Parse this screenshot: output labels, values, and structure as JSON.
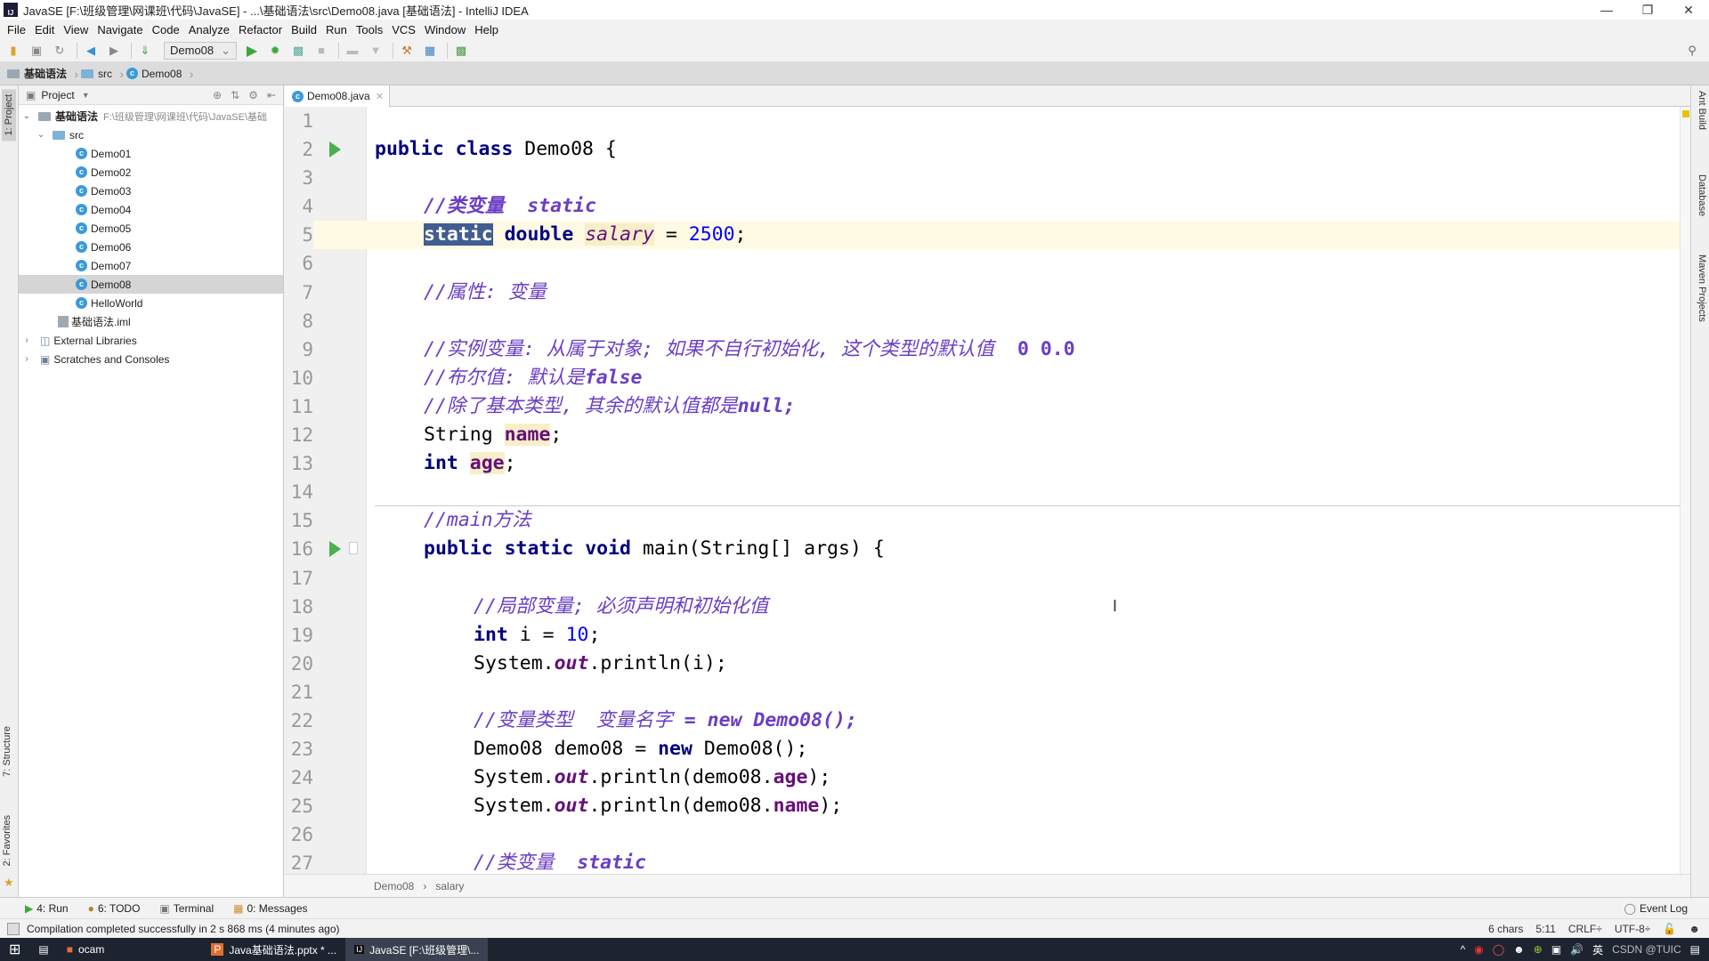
{
  "window": {
    "title": "JavaSE [F:\\班级管理\\网课班\\代码\\JavaSE] - ...\\基础语法\\src\\Demo08.java [基础语法] - IntelliJ IDEA",
    "app_icon": "IJ",
    "controls": [
      "minimize",
      "restore",
      "close"
    ]
  },
  "menu": [
    "File",
    "Edit",
    "View",
    "Navigate",
    "Code",
    "Analyze",
    "Refactor",
    "Build",
    "Run",
    "Tools",
    "VCS",
    "Window",
    "Help"
  ],
  "toolbar": {
    "run_config": "Demo08",
    "icons": [
      "open-icon",
      "save-icon",
      "sync-icon",
      "back-icon",
      "forward-icon",
      "build-icon",
      "run-icon",
      "debug-icon",
      "coverage-icon",
      "stop-icon",
      "project-structure-icon",
      "sdk-icon",
      "settings-icon",
      "search-icon"
    ]
  },
  "breadcrumb": [
    "基础语法",
    "src",
    "Demo08"
  ],
  "left_strip": {
    "project": "1: Project",
    "structure": "7: Structure",
    "favorites": "2: Favorites"
  },
  "right_strip": [
    "Ant Build",
    "Database",
    "Maven Projects"
  ],
  "project_panel": {
    "title": "Project",
    "root": {
      "name": "基础语法",
      "path": "F:\\班级管理\\网课班\\代码\\JavaSE\\基础"
    },
    "src": "src",
    "classes": [
      "Demo01",
      "Demo02",
      "Demo03",
      "Demo04",
      "Demo05",
      "Demo06",
      "Demo07",
      "Demo08",
      "HelloWorld"
    ],
    "selected": "Demo08",
    "iml": "基础语法.iml",
    "external": "External Libraries",
    "scratches": "Scratches and Consoles"
  },
  "editor": {
    "tab": "Demo08.java",
    "lines": {
      "l2a": "public class",
      "l2b": " Demo08 {",
      "l4": "//类变量  static",
      "l5a": "static",
      "l5b": " double ",
      "l5c": "salary",
      "l5d": " = ",
      "l5e": "2500",
      "l5f": ";",
      "l7": "//属性: 变量",
      "l9a": "//实例变量: 从属于对象; 如果不自行初始化, 这个类型的默认值  ",
      "l9b": "0 0.0",
      "l10a": "//布尔值: 默认是",
      "l10b": "false",
      "l11a": "//除了基本类型, 其余的默认值都是",
      "l11b": "null;",
      "l12a": "String ",
      "l12b": "name",
      "l12c": ";",
      "l13a": "int",
      "l13b": " ",
      "l13c": "age",
      "l13d": ";",
      "l15a": "//main",
      "l15b": "方法",
      "l16a": "public static void",
      "l16b": " main(String[] args) {",
      "l18": "//局部变量; 必须声明和初始化值",
      "l19a": "int",
      "l19b": " i = ",
      "l19c": "10",
      "l19d": ";",
      "l20a": "System.",
      "l20b": "out",
      "l20c": ".println(i);",
      "l22a": "//变量类型  变量名字 ",
      "l22b": "= new Demo08();",
      "l23a": "Demo08 demo08 = ",
      "l23b": "new",
      "l23c": " Demo08();",
      "l24a": "System.",
      "l24b": "out",
      "l24c": ".println(demo08.",
      "l24d": "age",
      "l24e": ");",
      "l25a": "System.",
      "l25b": "out",
      "l25c": ".println(demo08.",
      "l25d": "name",
      "l25e": ");",
      "l27a": "//类变量  ",
      "l27b": "static"
    },
    "line_numbers": [
      "1",
      "2",
      "3",
      "4",
      "5",
      "6",
      "7",
      "8",
      "9",
      "10",
      "11",
      "12",
      "13",
      "14",
      "15",
      "16",
      "17",
      "18",
      "19",
      "20",
      "21",
      "22",
      "23",
      "24",
      "25",
      "26",
      "27"
    ],
    "code_breadcrumb": [
      "Demo08",
      "salary"
    ]
  },
  "tool_windows": [
    "4: Run",
    "6: TODO",
    "Terminal",
    "0: Messages"
  ],
  "event_log": "Event Log",
  "status": {
    "message": "Compilation completed successfully in 2 s 868 ms (4 minutes ago)",
    "chars": "6 chars",
    "position": "5:11",
    "line_sep": "CRLF÷",
    "encoding": "UTF-8÷"
  },
  "taskbar": {
    "items": [
      "ocam",
      "Java基础语法.pptx * ...",
      "JavaSE [F:\\班级管理\\..."
    ],
    "tray": [
      "^",
      "英"
    ],
    "watermark": "CSDN @TUIC"
  }
}
